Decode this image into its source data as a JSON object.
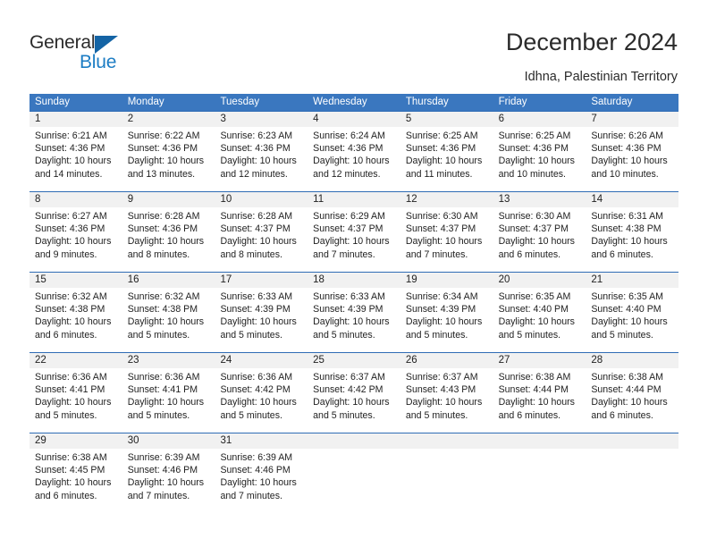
{
  "brand": {
    "name_part1": "General",
    "name_part2": "Blue",
    "triangle_icon": "triangle-icon",
    "accent_blue": "#1d7dc4",
    "dark_blue": "#1464a5"
  },
  "header": {
    "title": "December 2024",
    "subtitle": "Idhna, Palestinian Territory"
  },
  "calendar": {
    "header_bg": "#3a77bf",
    "row_divider": "#2f6cb5",
    "daynum_bg": "#f1f1f1",
    "weekdays": [
      "Sunday",
      "Monday",
      "Tuesday",
      "Wednesday",
      "Thursday",
      "Friday",
      "Saturday"
    ],
    "weeks": [
      [
        {
          "day": "1",
          "sunrise": "Sunrise: 6:21 AM",
          "sunset": "Sunset: 4:36 PM",
          "daylight1": "Daylight: 10 hours",
          "daylight2": "and 14 minutes."
        },
        {
          "day": "2",
          "sunrise": "Sunrise: 6:22 AM",
          "sunset": "Sunset: 4:36 PM",
          "daylight1": "Daylight: 10 hours",
          "daylight2": "and 13 minutes."
        },
        {
          "day": "3",
          "sunrise": "Sunrise: 6:23 AM",
          "sunset": "Sunset: 4:36 PM",
          "daylight1": "Daylight: 10 hours",
          "daylight2": "and 12 minutes."
        },
        {
          "day": "4",
          "sunrise": "Sunrise: 6:24 AM",
          "sunset": "Sunset: 4:36 PM",
          "daylight1": "Daylight: 10 hours",
          "daylight2": "and 12 minutes."
        },
        {
          "day": "5",
          "sunrise": "Sunrise: 6:25 AM",
          "sunset": "Sunset: 4:36 PM",
          "daylight1": "Daylight: 10 hours",
          "daylight2": "and 11 minutes."
        },
        {
          "day": "6",
          "sunrise": "Sunrise: 6:25 AM",
          "sunset": "Sunset: 4:36 PM",
          "daylight1": "Daylight: 10 hours",
          "daylight2": "and 10 minutes."
        },
        {
          "day": "7",
          "sunrise": "Sunrise: 6:26 AM",
          "sunset": "Sunset: 4:36 PM",
          "daylight1": "Daylight: 10 hours",
          "daylight2": "and 10 minutes."
        }
      ],
      [
        {
          "day": "8",
          "sunrise": "Sunrise: 6:27 AM",
          "sunset": "Sunset: 4:36 PM",
          "daylight1": "Daylight: 10 hours",
          "daylight2": "and 9 minutes."
        },
        {
          "day": "9",
          "sunrise": "Sunrise: 6:28 AM",
          "sunset": "Sunset: 4:36 PM",
          "daylight1": "Daylight: 10 hours",
          "daylight2": "and 8 minutes."
        },
        {
          "day": "10",
          "sunrise": "Sunrise: 6:28 AM",
          "sunset": "Sunset: 4:37 PM",
          "daylight1": "Daylight: 10 hours",
          "daylight2": "and 8 minutes."
        },
        {
          "day": "11",
          "sunrise": "Sunrise: 6:29 AM",
          "sunset": "Sunset: 4:37 PM",
          "daylight1": "Daylight: 10 hours",
          "daylight2": "and 7 minutes."
        },
        {
          "day": "12",
          "sunrise": "Sunrise: 6:30 AM",
          "sunset": "Sunset: 4:37 PM",
          "daylight1": "Daylight: 10 hours",
          "daylight2": "and 7 minutes."
        },
        {
          "day": "13",
          "sunrise": "Sunrise: 6:30 AM",
          "sunset": "Sunset: 4:37 PM",
          "daylight1": "Daylight: 10 hours",
          "daylight2": "and 6 minutes."
        },
        {
          "day": "14",
          "sunrise": "Sunrise: 6:31 AM",
          "sunset": "Sunset: 4:38 PM",
          "daylight1": "Daylight: 10 hours",
          "daylight2": "and 6 minutes."
        }
      ],
      [
        {
          "day": "15",
          "sunrise": "Sunrise: 6:32 AM",
          "sunset": "Sunset: 4:38 PM",
          "daylight1": "Daylight: 10 hours",
          "daylight2": "and 6 minutes."
        },
        {
          "day": "16",
          "sunrise": "Sunrise: 6:32 AM",
          "sunset": "Sunset: 4:38 PM",
          "daylight1": "Daylight: 10 hours",
          "daylight2": "and 5 minutes."
        },
        {
          "day": "17",
          "sunrise": "Sunrise: 6:33 AM",
          "sunset": "Sunset: 4:39 PM",
          "daylight1": "Daylight: 10 hours",
          "daylight2": "and 5 minutes."
        },
        {
          "day": "18",
          "sunrise": "Sunrise: 6:33 AM",
          "sunset": "Sunset: 4:39 PM",
          "daylight1": "Daylight: 10 hours",
          "daylight2": "and 5 minutes."
        },
        {
          "day": "19",
          "sunrise": "Sunrise: 6:34 AM",
          "sunset": "Sunset: 4:39 PM",
          "daylight1": "Daylight: 10 hours",
          "daylight2": "and 5 minutes."
        },
        {
          "day": "20",
          "sunrise": "Sunrise: 6:35 AM",
          "sunset": "Sunset: 4:40 PM",
          "daylight1": "Daylight: 10 hours",
          "daylight2": "and 5 minutes."
        },
        {
          "day": "21",
          "sunrise": "Sunrise: 6:35 AM",
          "sunset": "Sunset: 4:40 PM",
          "daylight1": "Daylight: 10 hours",
          "daylight2": "and 5 minutes."
        }
      ],
      [
        {
          "day": "22",
          "sunrise": "Sunrise: 6:36 AM",
          "sunset": "Sunset: 4:41 PM",
          "daylight1": "Daylight: 10 hours",
          "daylight2": "and 5 minutes."
        },
        {
          "day": "23",
          "sunrise": "Sunrise: 6:36 AM",
          "sunset": "Sunset: 4:41 PM",
          "daylight1": "Daylight: 10 hours",
          "daylight2": "and 5 minutes."
        },
        {
          "day": "24",
          "sunrise": "Sunrise: 6:36 AM",
          "sunset": "Sunset: 4:42 PM",
          "daylight1": "Daylight: 10 hours",
          "daylight2": "and 5 minutes."
        },
        {
          "day": "25",
          "sunrise": "Sunrise: 6:37 AM",
          "sunset": "Sunset: 4:42 PM",
          "daylight1": "Daylight: 10 hours",
          "daylight2": "and 5 minutes."
        },
        {
          "day": "26",
          "sunrise": "Sunrise: 6:37 AM",
          "sunset": "Sunset: 4:43 PM",
          "daylight1": "Daylight: 10 hours",
          "daylight2": "and 5 minutes."
        },
        {
          "day": "27",
          "sunrise": "Sunrise: 6:38 AM",
          "sunset": "Sunset: 4:44 PM",
          "daylight1": "Daylight: 10 hours",
          "daylight2": "and 6 minutes."
        },
        {
          "day": "28",
          "sunrise": "Sunrise: 6:38 AM",
          "sunset": "Sunset: 4:44 PM",
          "daylight1": "Daylight: 10 hours",
          "daylight2": "and 6 minutes."
        }
      ],
      [
        {
          "day": "29",
          "sunrise": "Sunrise: 6:38 AM",
          "sunset": "Sunset: 4:45 PM",
          "daylight1": "Daylight: 10 hours",
          "daylight2": "and 6 minutes."
        },
        {
          "day": "30",
          "sunrise": "Sunrise: 6:39 AM",
          "sunset": "Sunset: 4:46 PM",
          "daylight1": "Daylight: 10 hours",
          "daylight2": "and 7 minutes."
        },
        {
          "day": "31",
          "sunrise": "Sunrise: 6:39 AM",
          "sunset": "Sunset: 4:46 PM",
          "daylight1": "Daylight: 10 hours",
          "daylight2": "and 7 minutes."
        },
        {
          "day": "",
          "sunrise": "",
          "sunset": "",
          "daylight1": "",
          "daylight2": ""
        },
        {
          "day": "",
          "sunrise": "",
          "sunset": "",
          "daylight1": "",
          "daylight2": ""
        },
        {
          "day": "",
          "sunrise": "",
          "sunset": "",
          "daylight1": "",
          "daylight2": ""
        },
        {
          "day": "",
          "sunrise": "",
          "sunset": "",
          "daylight1": "",
          "daylight2": ""
        }
      ]
    ]
  }
}
